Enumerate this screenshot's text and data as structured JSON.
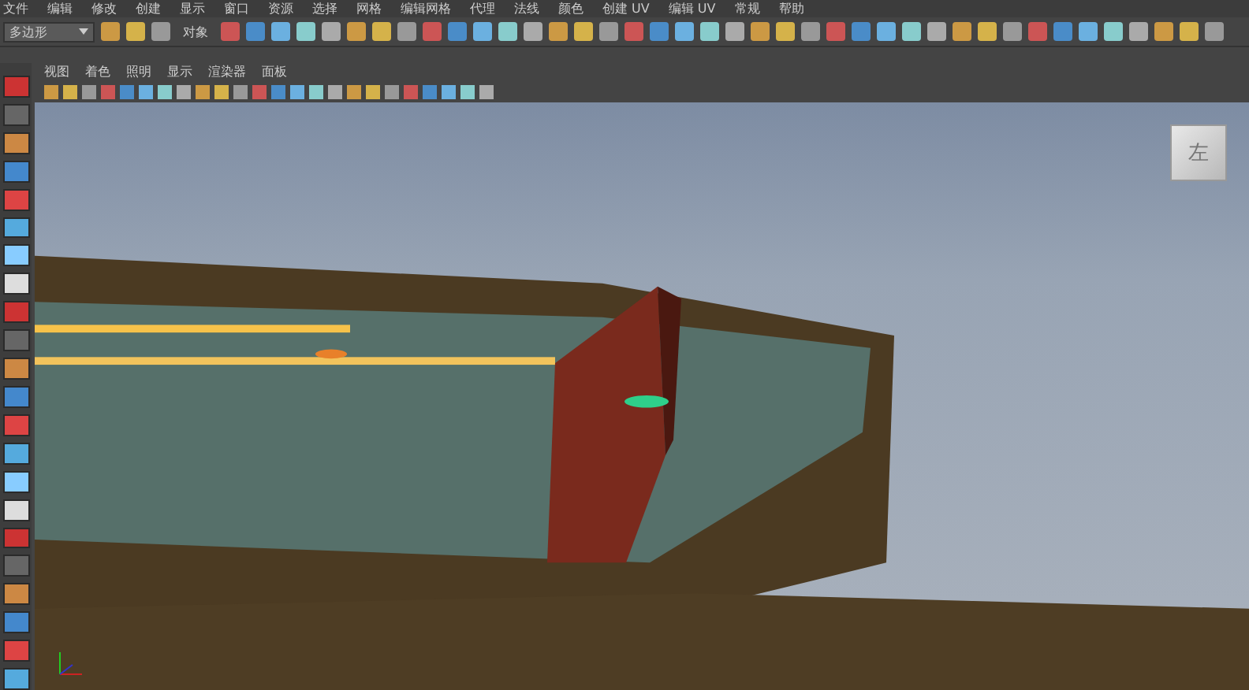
{
  "menu_bar": {
    "items": [
      "文件",
      "编辑",
      "修改",
      "创建",
      "显示",
      "窗口",
      "资源",
      "选择",
      "网格",
      "编辑网格",
      "代理",
      "法线",
      "颜色",
      "创建 UV",
      "编辑 UV",
      "常规",
      "帮助"
    ]
  },
  "status_line": {
    "mode_dropdown": "多边形",
    "selection_field": "对象"
  },
  "panel_menu": {
    "items": [
      "视图",
      "着色",
      "照明",
      "显示",
      "渲染器",
      "面板"
    ]
  },
  "viewport": {
    "view_cube_label": "左"
  }
}
